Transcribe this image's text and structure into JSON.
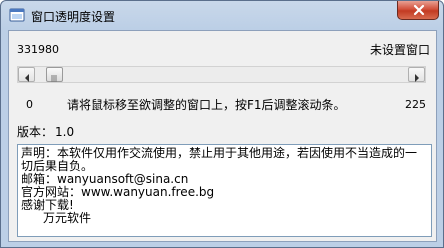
{
  "window": {
    "title": "窗口透明度设置",
    "accent_color": "#c23a22",
    "icons": {
      "app": "app-icon",
      "close": "close-icon"
    }
  },
  "header": {
    "left_value": "331980",
    "status_text": "未设置窗口"
  },
  "slider": {
    "position_fraction": 0.03,
    "min_label": "0",
    "max_label": "225",
    "instruction": "请将鼠标移至欲调整的窗口上，按F1后调整滚动条。"
  },
  "version": {
    "label": "版本：",
    "value": "1.0"
  },
  "notice": {
    "line1": "声明：本软件仅用作交流使用，禁止用于其他用途，若因使用不当造成的一切后果自负。",
    "line2": "邮箱：wanyuansoft@sina.cn",
    "line3": "官方网站：www.wanyuan.free.bg",
    "line4": "感谢下载!",
    "signature": "万元软件"
  }
}
